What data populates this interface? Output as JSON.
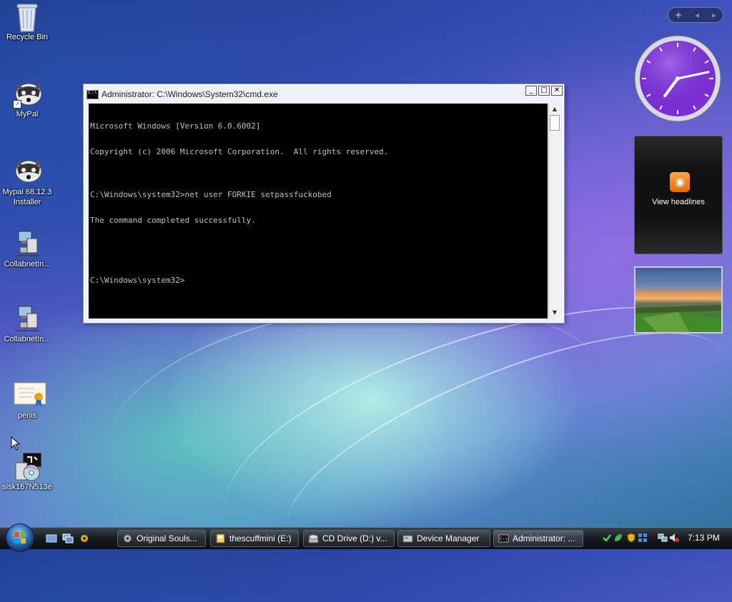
{
  "desktop_icons": [
    {
      "name": "recycle-bin",
      "label": "Recycle Bin",
      "icon": "recycle-bin-icon"
    },
    {
      "name": "mypal",
      "label": "MyPal",
      "icon": "raccoon-icon"
    },
    {
      "name": "mypal-installer",
      "label_line1": "Mypal 68.12.3",
      "label_line2": "Installer",
      "icon": "raccoon-icon"
    },
    {
      "name": "collabnet-1",
      "label": "CollabnetIn...",
      "icon": "computer-network-icon"
    },
    {
      "name": "collabnet-2",
      "label": "CollabnetIn...",
      "icon": "computer-network-icon"
    },
    {
      "name": "penis",
      "label": "penis",
      "icon": "certificate-icon"
    },
    {
      "name": "sisk",
      "label": "sisk167N513e",
      "icon": "installer-disc-icon"
    }
  ],
  "cmd_window": {
    "title": "Administrator: C:\\Windows\\System32\\cmd.exe",
    "minimize": "_",
    "maximize": "□",
    "close": "✕",
    "lines": [
      "Microsoft Windows [Version 6.0.6002]",
      "Copyright (c) 2006 Microsoft Corporation.  All rights reserved.",
      "",
      "C:\\Windows\\system32>net user FORKIE setpassfuckobed",
      "The command completed successfully.",
      "",
      "",
      "C:\\Windows\\system32>"
    ]
  },
  "sidebar": {
    "add_button": "+",
    "prev_button": "◂",
    "next_button": "▸",
    "clock": {
      "hour": 7,
      "minute": 13
    },
    "feed_label": "View headlines"
  },
  "taskbar": {
    "tasks": [
      {
        "label": "Original Souls...",
        "icon": "gear-icon"
      },
      {
        "label": "thescuffmini (E:)",
        "icon": "drive-icon"
      },
      {
        "label": "CD Drive (D:) v...",
        "icon": "cd-drive-icon"
      },
      {
        "label": "Device Manager",
        "icon": "device-manager-icon"
      },
      {
        "label": "Administrator: ...",
        "icon": "cmd-icon"
      }
    ],
    "time": "7:13 PM"
  },
  "colors": {
    "console_bg": "#000000",
    "console_text": "#c0c0c0",
    "taskbar": "#161b20",
    "clock_face": "#7b2fd6",
    "rss": "#f08a1c"
  }
}
